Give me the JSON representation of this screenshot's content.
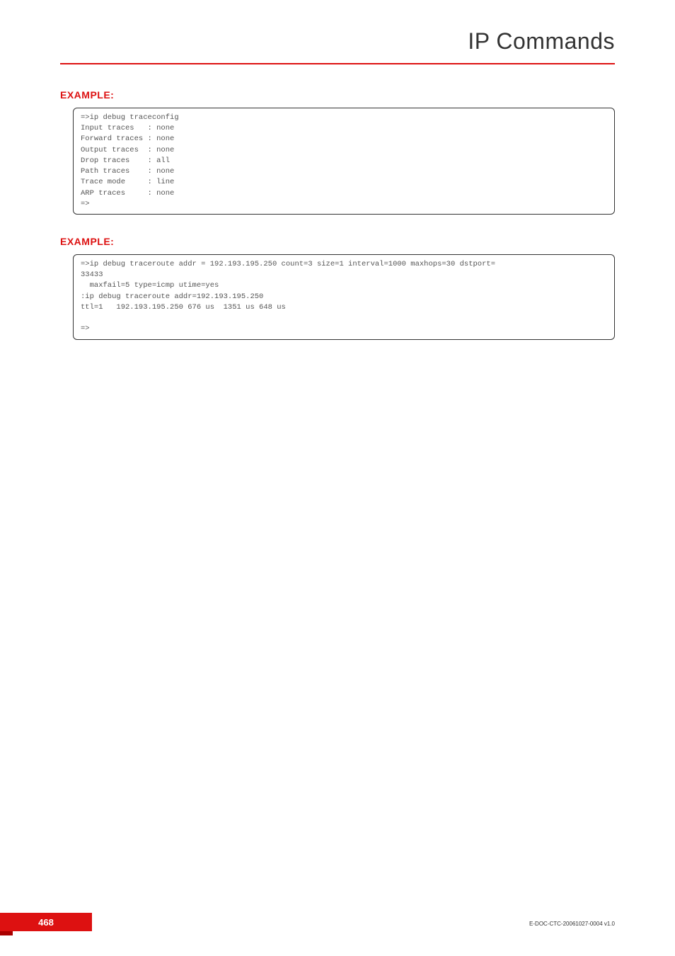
{
  "header": {
    "title": "IP Commands"
  },
  "sections": {
    "example1": {
      "heading": "EXAMPLE:",
      "code": "=>ip debug traceconfig\nInput traces   : none\nForward traces : none\nOutput traces  : none\nDrop traces    : all\nPath traces    : none\nTrace mode     : line\nARP traces     : none\n=>"
    },
    "example2": {
      "heading": "EXAMPLE:",
      "code": "=>ip debug traceroute addr = 192.193.195.250 count=3 size=1 interval=1000 maxhops=30 dstport=\n33433\n  maxfail=5 type=icmp utime=yes\n:ip debug traceroute addr=192.193.195.250\nttl=1   192.193.195.250 676 us  1351 us 648 us\n\n=>"
    }
  },
  "footer": {
    "page_number": "468",
    "doc_id": "E-DOC-CTC-20061027-0004 v1.0"
  }
}
